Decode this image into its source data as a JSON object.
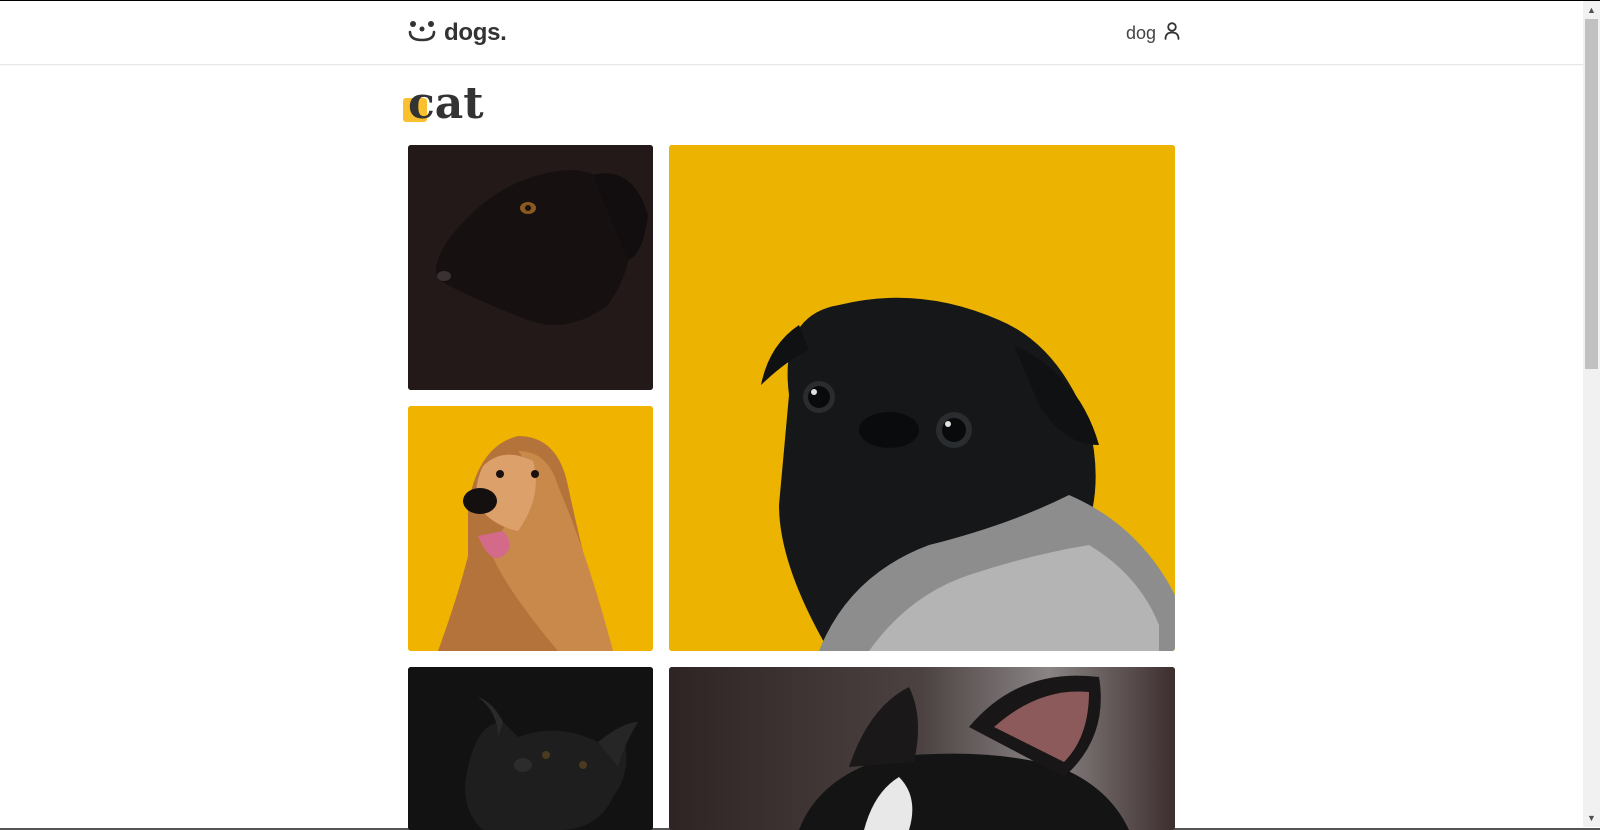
{
  "header": {
    "logo_text": "dogs.",
    "logo_icon": "dog-face-icon",
    "user_label": "dog",
    "user_icon": "user-icon"
  },
  "page": {
    "title": "cat"
  },
  "photos": [
    {
      "subject": "black dog profile on dark background",
      "bg": "#231919"
    },
    {
      "subject": "black pug in knit sweater on yellow background",
      "bg": "#ecb400"
    },
    {
      "subject": "afghan hound on yellow background",
      "bg": "#efb300"
    },
    {
      "subject": "black fluffy dog on dark background",
      "bg": "#121212"
    },
    {
      "subject": "french bulldog close-up",
      "bg": "#4a3d3d"
    }
  ],
  "colors": {
    "accent": "#fbc02d",
    "text": "#333333"
  }
}
